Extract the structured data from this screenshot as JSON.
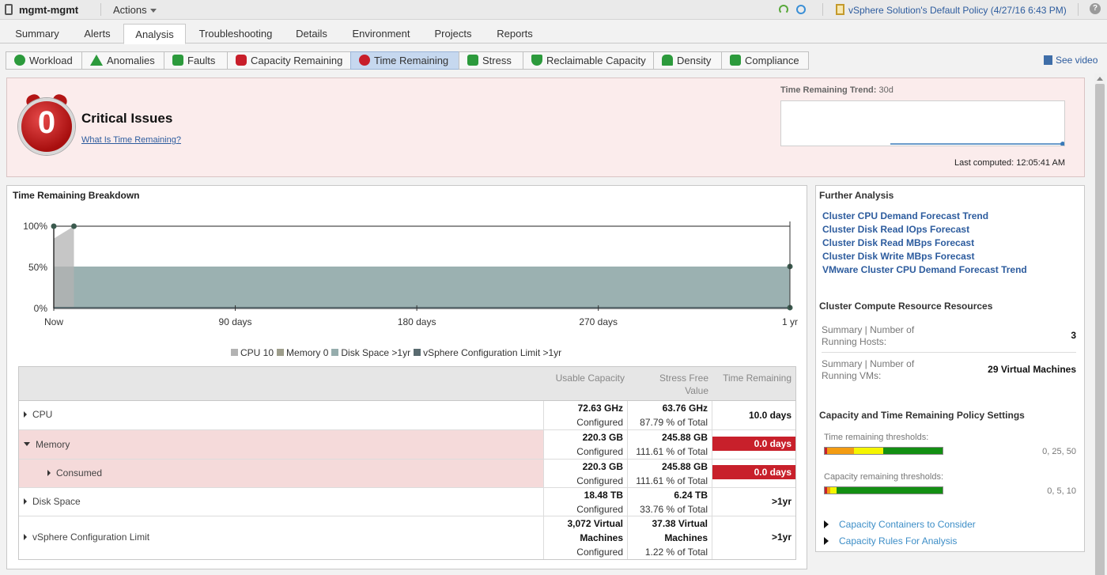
{
  "topbar": {
    "object_name": "mgmt-mgmt",
    "actions_label": "Actions",
    "policy_text": "vSphere Solution's Default Policy (4/27/16 6:43 PM)",
    "help_label": "?"
  },
  "tabs": [
    {
      "label": "Summary"
    },
    {
      "label": "Alerts"
    },
    {
      "label": "Analysis",
      "active": true
    },
    {
      "label": "Troubleshooting"
    },
    {
      "label": "Details"
    },
    {
      "label": "Environment"
    },
    {
      "label": "Projects"
    },
    {
      "label": "Reports"
    }
  ],
  "badges": [
    {
      "label": "Workload",
      "icon": "workload-icon"
    },
    {
      "label": "Anomalies",
      "icon": "anomalies-icon"
    },
    {
      "label": "Faults",
      "icon": "faults-icon"
    },
    {
      "label": "Capacity Remaining",
      "icon": "capacity-remaining-icon"
    },
    {
      "label": "Time Remaining",
      "icon": "time-remaining-icon",
      "active": true
    },
    {
      "label": "Stress",
      "icon": "stress-icon"
    },
    {
      "label": "Reclaimable Capacity",
      "icon": "reclaimable-capacity-icon"
    },
    {
      "label": "Density",
      "icon": "density-icon"
    },
    {
      "label": "Compliance",
      "icon": "compliance-icon"
    }
  ],
  "see_video": "See video",
  "critical": {
    "value": "0",
    "title": "Critical Issues",
    "link": "What Is Time Remaining?",
    "trend_label": "Time Remaining Trend:",
    "trend_period": "30d",
    "last_computed": "Last computed: 12:05:41 AM"
  },
  "breakdown": {
    "title": "Time Remaining Breakdown",
    "table_headers": {
      "usable": "Usable Capacity",
      "stress": "Stress Free Value",
      "time": "Time Remaining"
    },
    "rows": [
      {
        "name": "CPU",
        "usable_top": "72.63 GHz",
        "usable_bottom": "Configured",
        "stress_top": "63.76 GHz",
        "stress_bottom": "87.79 % of Total",
        "time": "10.0 days"
      },
      {
        "name": "Memory",
        "usable_top": "220.3 GB",
        "usable_bottom": "Configured",
        "stress_top": "245.88 GB",
        "stress_bottom": "111.61 % of Total",
        "time": "0.0 days"
      },
      {
        "name": "Consumed",
        "usable_top": "220.3 GB",
        "usable_bottom": "Configured",
        "stress_top": "245.88 GB",
        "stress_bottom": "111.61 % of Total",
        "time": "0.0 days"
      },
      {
        "name": "Disk Space",
        "usable_top": "18.48 TB",
        "usable_bottom": "Configured",
        "stress_top": "6.24 TB",
        "stress_bottom": "33.76 % of Total",
        "time": ">1yr"
      },
      {
        "name": "vSphere Configuration Limit",
        "usable_top": "3,072 Virtual",
        "usable_mid": "Machines",
        "usable_bottom": "Configured",
        "stress_top": "37.38 Virtual",
        "stress_mid": "Machines",
        "stress_bottom": "1.22 % of Total",
        "time": ">1yr"
      }
    ]
  },
  "chart_data": {
    "type": "area",
    "x_tick_labels": [
      "Now",
      "90 days",
      "180 days",
      "270 days",
      "1 yr"
    ],
    "y_tick_labels": [
      "100%",
      "50%",
      "0%"
    ],
    "x_range_days": [
      0,
      365
    ],
    "ylim": [
      0,
      100
    ],
    "series": [
      {
        "name": "CPU 10",
        "color": "#b3b3b3",
        "x_days": [
          0,
          10,
          10
        ],
        "y": [
          85,
          100,
          0
        ]
      },
      {
        "name": "Memory 0",
        "color": "#9e9e8c",
        "x_days": [
          0,
          0
        ],
        "y": [
          100,
          0
        ]
      },
      {
        "name": "Disk Space >1yr",
        "color": "#96adad",
        "x_days": [
          0,
          365
        ],
        "y": [
          51,
          51
        ]
      },
      {
        "name": "vSphere Configuration Limit >1yr",
        "color": "#5a6b70",
        "x_days": [
          0,
          365
        ],
        "y": [
          1,
          1
        ]
      }
    ],
    "legend_position": "bottom"
  },
  "further": {
    "title": "Further Analysis",
    "links": [
      "Cluster CPU Demand Forecast Trend",
      "Cluster Disk Read IOps Forecast",
      "Cluster Disk Read MBps Forecast",
      "Cluster Disk Write MBps Forecast",
      "VMware Cluster CPU Demand Forecast Trend"
    ],
    "resources_title": "Cluster Compute Resource Resources",
    "hosts_label": "Summary | Number of Running Hosts:",
    "hosts_value": "3",
    "vms_label": "Summary | Number of Running VMs:",
    "vms_value": "29 Virtual Machines",
    "policy_title": "Capacity and Time Remaining Policy Settings",
    "time_thr_label": "Time remaining thresholds:",
    "time_thr_values": "0, 25, 50",
    "cap_thr_label": "Capacity remaining thresholds:",
    "cap_thr_values": "0, 5, 10",
    "expand_1": "Capacity Containers to Consider",
    "expand_2": "Capacity Rules For Analysis",
    "colors": {
      "red": "#c8202b",
      "orange": "#f39c12",
      "yellow": "#f5f500",
      "green": "#138f13"
    }
  }
}
